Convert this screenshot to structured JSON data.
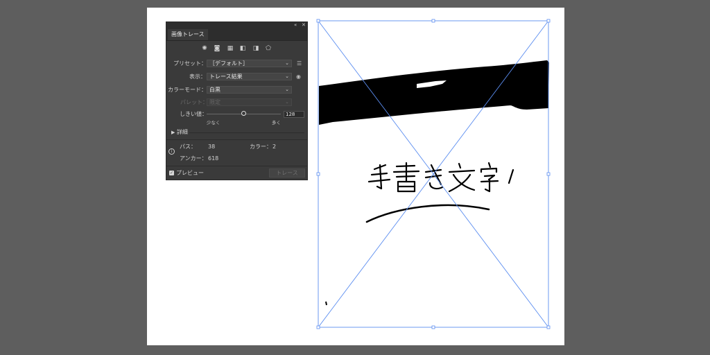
{
  "panel": {
    "collapse_icon": "«",
    "close_icon": "✕",
    "tab_label": "画像トレース",
    "toolbar_icons": [
      "auto-color-icon",
      "high-color-icon",
      "low-color-icon",
      "grayscale-icon",
      "black-white-icon",
      "outline-icon"
    ],
    "preset": {
      "label": "プリセット：",
      "value": "［デフォルト］"
    },
    "view": {
      "label": "表示：",
      "value": "トレース結果"
    },
    "mode": {
      "label": "カラーモード：",
      "value": "白黒"
    },
    "palette": {
      "label": "パレット：",
      "value": "限定"
    },
    "threshold": {
      "label": "しきい値：",
      "value": "128",
      "fraction": 0.5,
      "min_label": "少なく",
      "max_label": "多く"
    },
    "advanced_label": "詳細",
    "stats": {
      "paths_label": "パス：",
      "paths_value": "38",
      "colors_label": "カラー：",
      "colors_value": "2",
      "anchors_label": "アンカー：",
      "anchors_value": "618"
    },
    "preview_label": "プレビュー",
    "trace_button": "トレース"
  },
  "colors": {
    "selection": "#5b8df0",
    "ink": "#000000"
  }
}
